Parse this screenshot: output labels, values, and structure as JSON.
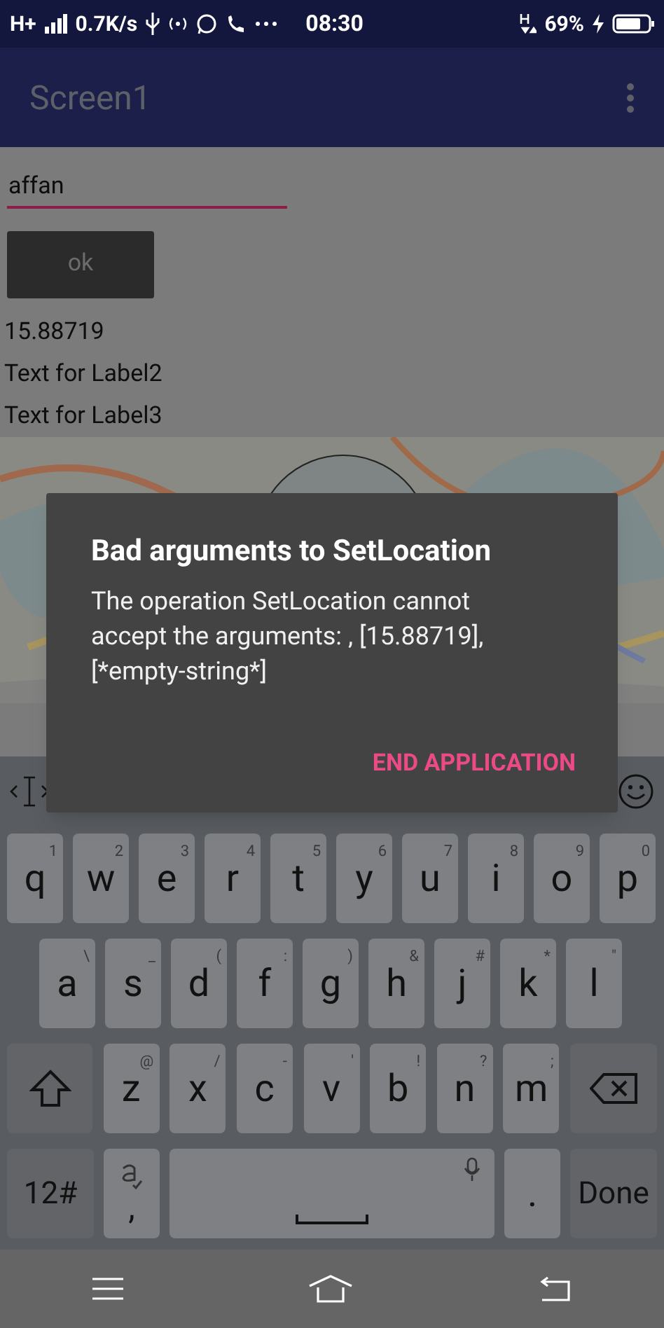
{
  "status_bar": {
    "network": "H+",
    "speed": "0.7K/s",
    "time": "08:30",
    "battery": "69%"
  },
  "app_bar": {
    "title": "Screen1"
  },
  "text_field": {
    "value": "affan"
  },
  "ok_button": {
    "label": "ok"
  },
  "labels": [
    "15.88719",
    "Text for Label2",
    "Text for Label3"
  ],
  "map": {
    "kind": "picture"
  },
  "dialog": {
    "title": "Bad arguments to SetLocation",
    "message": "The operation SetLocation cannot accept the arguments: , [15.88719], [*empty-string*]",
    "action": "END APPLICATION"
  },
  "keyboard": {
    "rows": [
      {
        "keys": [
          {
            "kind": "letter",
            "main": "q",
            "sub": "1"
          },
          {
            "kind": "letter",
            "main": "w",
            "sub": "2"
          },
          {
            "kind": "letter",
            "main": "e",
            "sub": "3"
          },
          {
            "kind": "letter",
            "main": "r",
            "sub": "4"
          },
          {
            "kind": "letter",
            "main": "t",
            "sub": "5"
          },
          {
            "kind": "letter",
            "main": "y",
            "sub": "6"
          },
          {
            "kind": "letter",
            "main": "u",
            "sub": "7"
          },
          {
            "kind": "letter",
            "main": "i",
            "sub": "8"
          },
          {
            "kind": "letter",
            "main": "o",
            "sub": "9"
          },
          {
            "kind": "letter",
            "main": "p",
            "sub": "0"
          }
        ]
      },
      {
        "keys": [
          {
            "kind": "letter",
            "main": "a",
            "sub": "\\"
          },
          {
            "kind": "letter",
            "main": "s",
            "sub": "_"
          },
          {
            "kind": "letter",
            "main": "d",
            "sub": "("
          },
          {
            "kind": "letter",
            "main": "f",
            "sub": ":"
          },
          {
            "kind": "letter",
            "main": "g",
            "sub": ")"
          },
          {
            "kind": "letter",
            "main": "h",
            "sub": "&"
          },
          {
            "kind": "letter",
            "main": "j",
            "sub": "#"
          },
          {
            "kind": "letter",
            "main": "k",
            "sub": "*"
          },
          {
            "kind": "letter",
            "main": "l",
            "sub": "\""
          }
        ]
      },
      {
        "keys": [
          {
            "kind": "shift"
          },
          {
            "kind": "letter",
            "main": "z",
            "sub": "@"
          },
          {
            "kind": "letter",
            "main": "x",
            "sub": "/"
          },
          {
            "kind": "letter",
            "main": "c",
            "sub": "-"
          },
          {
            "kind": "letter",
            "main": "v",
            "sub": "'"
          },
          {
            "kind": "letter",
            "main": "b",
            "sub": "!"
          },
          {
            "kind": "letter",
            "main": "n",
            "sub": "?"
          },
          {
            "kind": "letter",
            "main": "m",
            "sub": ";"
          },
          {
            "kind": "backspace"
          }
        ]
      },
      {
        "keys": [
          {
            "kind": "function",
            "main": "12#"
          },
          {
            "kind": "comma",
            "main": ","
          },
          {
            "kind": "space"
          },
          {
            "kind": "period",
            "main": "."
          },
          {
            "kind": "function",
            "main": "Done"
          }
        ]
      }
    ]
  }
}
